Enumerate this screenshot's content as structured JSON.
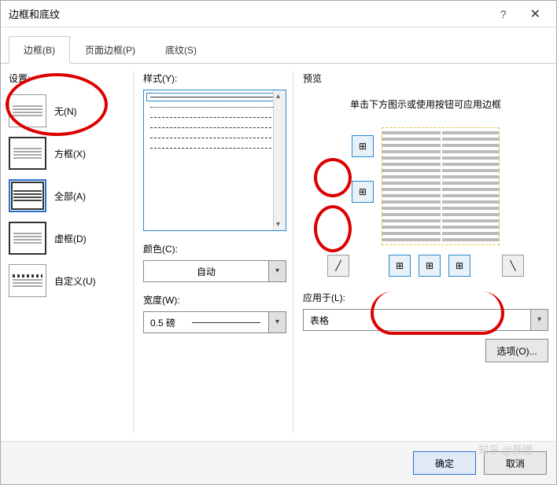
{
  "window": {
    "title": "边框和底纹"
  },
  "tabs": [
    {
      "label": "边框(B)",
      "active": true
    },
    {
      "label": "页面边框(P)",
      "active": false
    },
    {
      "label": "底纹(S)",
      "active": false
    }
  ],
  "settings": {
    "label": "设置:",
    "options": [
      {
        "id": "none",
        "label": "无(N)",
        "selected": false
      },
      {
        "id": "box",
        "label": "方框(X)",
        "selected": false
      },
      {
        "id": "all",
        "label": "全部(A)",
        "selected": true
      },
      {
        "id": "grid",
        "label": "虚框(D)",
        "selected": false
      },
      {
        "id": "custom",
        "label": "自定义(U)",
        "selected": false
      }
    ]
  },
  "style": {
    "label": "样式(Y):",
    "options": [
      "solid",
      "dotted",
      "dashed",
      "dashed",
      "dashdot",
      "dashdot"
    ],
    "selected_index": 0,
    "color_label": "颜色(C):",
    "color_value": "自动",
    "width_label": "宽度(W):",
    "width_value": "0.5 磅"
  },
  "preview": {
    "label": "预览",
    "message": "单击下方图示或使用按钮可应用边框",
    "apply_to_label": "应用于(L):",
    "apply_to_value": "表格",
    "options_button": "选项(O)..."
  },
  "footer": {
    "ok": "确定",
    "cancel": "取消"
  },
  "watermark": "知乎 @薇懞"
}
